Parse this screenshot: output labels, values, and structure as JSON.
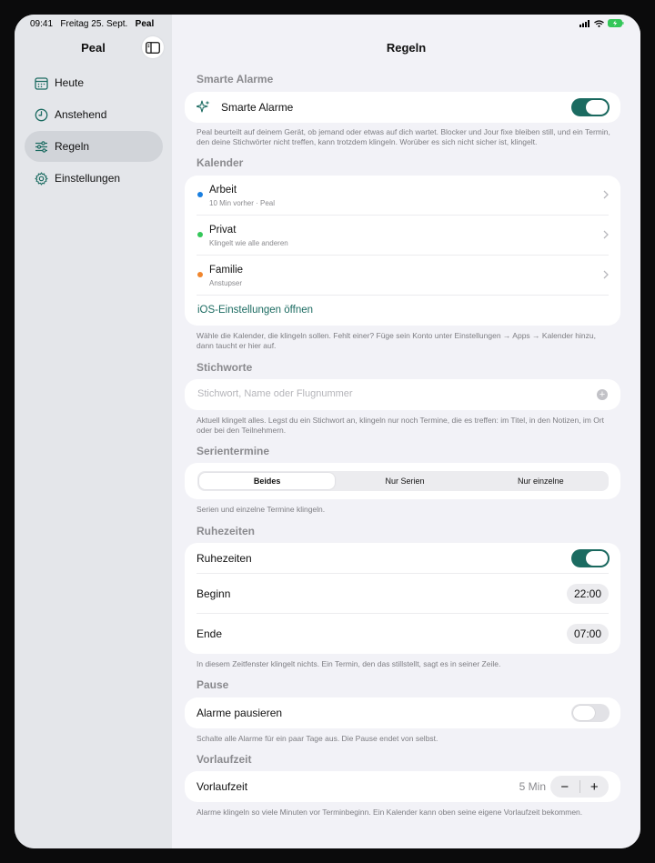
{
  "status": {
    "time": "09:41",
    "date": "Freitag 25. Sept.",
    "app": "Peal"
  },
  "sidebar": {
    "title": "Peal",
    "items": [
      {
        "label": "Heute",
        "icon": "calendar-icon"
      },
      {
        "label": "Anstehend",
        "icon": "clock-icon"
      },
      {
        "label": "Regeln",
        "icon": "sliders-icon",
        "active": true
      },
      {
        "label": "Einstellungen",
        "icon": "gear-icon"
      }
    ]
  },
  "main": {
    "title": "Regeln",
    "smart": {
      "header": "Smarte Alarme",
      "label": "Smarte Alarme",
      "enabled": true,
      "footer": "Peal beurteilt auf deinem Gerät, ob jemand oder etwas auf dich wartet. Blocker und Jour fixe bleiben still, und ein Termin, den deine Stichwörter nicht treffen, kann trotzdem klingeln. Worüber es sich nicht sicher ist, klingelt."
    },
    "calendars": {
      "header": "Kalender",
      "items": [
        {
          "name": "Arbeit",
          "detail": "10 Min vorher · Peal",
          "color": "#1a7fe0"
        },
        {
          "name": "Privat",
          "detail": "Klingelt wie alle anderen",
          "color": "#34c759"
        },
        {
          "name": "Familie",
          "detail": "Anstupser",
          "color": "#f0862e"
        }
      ],
      "link": "iOS-Einstellungen öffnen",
      "footer": "Wähle die Kalender, die klingeln sollen. Fehlt einer? Füge sein Konto unter Einstellungen → Apps → Kalender hinzu, dann taucht er hier auf."
    },
    "keywords": {
      "header": "Stichworte",
      "placeholder": "Stichwort, Name oder Flugnummer",
      "footer": "Aktuell klingelt alles. Legst du ein Stichwort an, klingeln nur noch Termine, die es treffen: im Titel, in den Notizen, im Ort oder bei den Teilnehmern."
    },
    "series": {
      "header": "Serientermine",
      "options": [
        "Beides",
        "Nur Serien",
        "Nur einzelne"
      ],
      "selected": "Beides",
      "footer": "Serien und einzelne Termine klingeln."
    },
    "quiet": {
      "header": "Ruhezeiten",
      "label": "Ruhezeiten",
      "enabled": true,
      "start_label": "Beginn",
      "start": "22:00",
      "end_label": "Ende",
      "end": "07:00",
      "footer": "In diesem Zeitfenster klingelt nichts. Ein Termin, den das stillstellt, sagt es in seiner Zeile."
    },
    "pause": {
      "header": "Pause",
      "label": "Alarme pausieren",
      "enabled": false,
      "footer": "Schalte alle Alarme für ein paar Tage aus. Die Pause endet von selbst."
    },
    "lead": {
      "header": "Vorlaufzeit",
      "label": "Vorlaufzeit",
      "value": "5 Min",
      "minus": "−",
      "plus": "+",
      "footer": "Alarme klingeln so viele Minuten vor Terminbeginn. Ein Kalender kann oben seine eigene Vorlaufzeit bekommen."
    }
  },
  "colors": {
    "accent": "#1b6b61",
    "background": "#f2f2f7",
    "sidebar": "#e4e6ea"
  }
}
